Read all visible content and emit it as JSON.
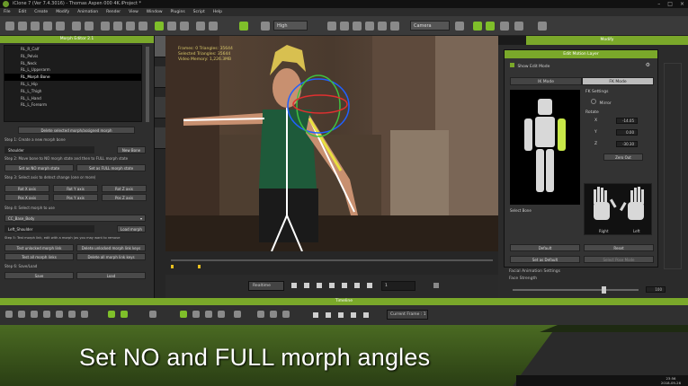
{
  "window": {
    "title": "iClone 7 (Ver 7.4.3016) - Thomas Aspen 000 4K.iProject *",
    "controls": [
      "–",
      "□",
      "×"
    ]
  },
  "menu": [
    "File",
    "Edit",
    "Create",
    "Modify",
    "Animation",
    "Render",
    "View",
    "Window",
    "Plugins",
    "Script",
    "Help"
  ],
  "toolbar": {
    "quality": "High",
    "camera": "Camera"
  },
  "morph_panel": {
    "title": "Morph Editor 2.1",
    "bones": [
      "RL_R_Calf",
      "RL_Pelvis",
      "RL_Neck",
      "RL_L_Upperarm",
      "RL_Morph Bone",
      "RL_L_Hip",
      "RL_L_Thigh",
      "RL_L_Hand",
      "RL_L_Forearm"
    ],
    "selected_index": 4,
    "btn_delete": "Delete selected morph/assigned morph",
    "step1": "Step 1: Create a new morph bone",
    "field_shoulder": "Shoulder",
    "btn_new_bone": "New Bone",
    "step2": "Step 2: Move bone to NO morph state and then to FULL morph state",
    "btn_set_no": "Set as NO morph state",
    "btn_set_full": "Set as FULL morph state",
    "step3": "Step 3: Select axis to detect change (one or more)",
    "axis_buttons": [
      "Rot X axis",
      "Rot Y axis",
      "Rot Z axis",
      "Pos X axis",
      "Pos Y axis",
      "Pos Z axis"
    ],
    "step4": "Step 4: Select morph to use",
    "dropdown_body": "CC_Base_Body",
    "field_morph": "Left_Shoulder",
    "btn_load_morph": "Load morph",
    "step5": "Step 5: Test morph link, edit with a morph (as you may want to remove",
    "test_buttons": [
      "Test unlocked morph link",
      "Delete unlocked morph link keys",
      "Test all morph links",
      "Delete all morph link keys"
    ],
    "step6": "Step 6: Save/Load",
    "btn_save": "Save",
    "btn_load": "Load"
  },
  "viewport": {
    "info_lines": [
      "Frames: 0   Triangles: 35644",
      "Selected Triangles: 35644",
      "Video Memory: 1,226.3MB"
    ]
  },
  "transport": {
    "mode": "Realtime",
    "frame": "1"
  },
  "right_panel": {
    "title": "Modify"
  },
  "edit_motion": {
    "title": "Edit Motion Layer",
    "checkbox_label": "Show Edit Mode",
    "tabs": [
      "IK Mode",
      "FK Mode"
    ],
    "active_tab": 1,
    "fk_settings": "FK Settings",
    "mirror": "Mirror",
    "rotate": "Rotate",
    "rot_axes": [
      "X",
      "Y",
      "Z"
    ],
    "rot_values": [
      "-14.05",
      "0.00",
      "-30.30"
    ],
    "btn_zero": "Zero Out",
    "select_bone": "Select Bone",
    "hand_right": "Right",
    "hand_left": "Left",
    "btn_default": "Default",
    "btn_reset": "Reset",
    "btn_set_default": "Set as Default",
    "btn_pose_mode": "Select Pose Mode"
  },
  "facial": {
    "title": "Facial Animation Settings",
    "strength_label": "Face Strength",
    "strength_value": "100",
    "strength_fraction": 0.72
  },
  "timeline": {
    "title": "Timeline",
    "current_frame_label": "Current Frame :",
    "current_frame": "1"
  },
  "banner": {
    "text": "Set NO and FULL morph angles"
  },
  "taskbar": {
    "time": "23:56",
    "date": "2018-09-26"
  },
  "colors": {
    "accent": "#7aa82a",
    "banner_green": "#3c5a1c",
    "banner_dark": "#1e2a12"
  }
}
